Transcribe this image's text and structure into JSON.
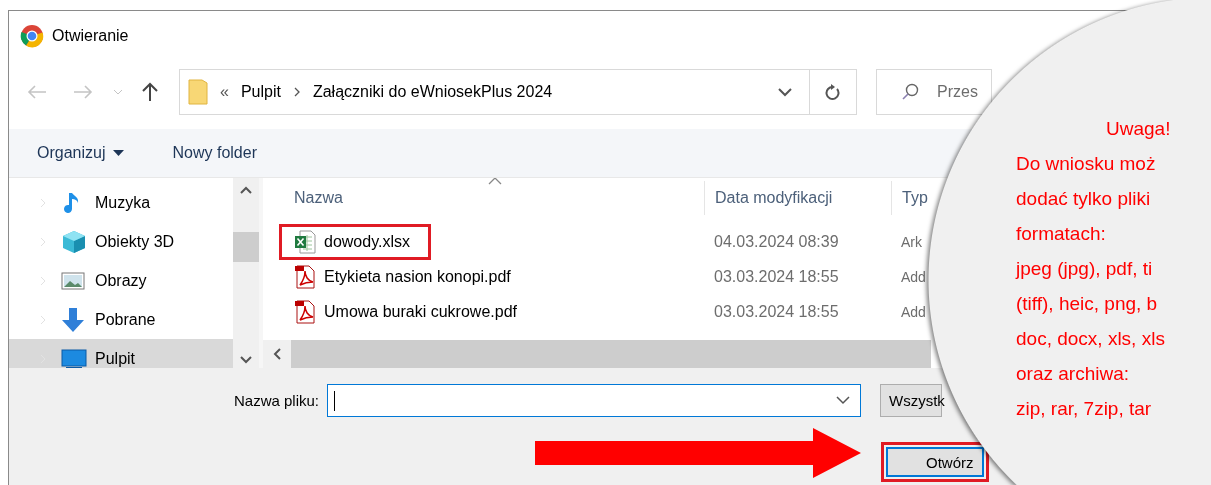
{
  "window": {
    "title": "Otwieranie"
  },
  "address_bar": {
    "overflow": "«",
    "breadcrumbs": [
      "Pulpit",
      "Załączniki do eWniosekPlus 2024"
    ]
  },
  "search": {
    "placeholder": "Przes"
  },
  "toolbar": {
    "organize": "Organizuj",
    "new_folder": "Nowy folder"
  },
  "nav_pane": {
    "items": [
      {
        "label": "Muzyka",
        "kind": "music",
        "selected": false
      },
      {
        "label": "Obiekty 3D",
        "kind": "cube",
        "selected": false
      },
      {
        "label": "Obrazy",
        "kind": "pictures",
        "selected": false
      },
      {
        "label": "Pobrane",
        "kind": "download",
        "selected": false
      },
      {
        "label": "Pulpit",
        "kind": "desktop",
        "selected": true
      }
    ]
  },
  "file_list": {
    "columns": [
      "Nazwa",
      "Data modyfikacji",
      "Typ"
    ],
    "rows": [
      {
        "name": "dowody.xlsx",
        "kind": "excel",
        "date": "04.03.2024 08:39",
        "type": "Ark",
        "highlighted": true
      },
      {
        "name": "Etykieta nasion konopi.pdf",
        "kind": "pdf",
        "date": "03.03.2024 18:55",
        "type": "Add",
        "highlighted": false
      },
      {
        "name": "Umowa buraki cukrowe.pdf",
        "kind": "pdf",
        "date": "03.03.2024 18:55",
        "type": "Add",
        "highlighted": false
      }
    ]
  },
  "file_name": {
    "label": "Nazwa pliku:"
  },
  "file_type_filter": {
    "value": "Wszystk"
  },
  "open_button": {
    "label": "Otwórz",
    "highlighted": true
  },
  "callout": {
    "heading": "Uwaga!",
    "lines": [
      "Do wniosku moż",
      "dodać tylko pliki",
      "formatach:",
      "jpeg (jpg), pdf, ti",
      "(tiff), heic, png, b",
      "doc, docx, xls, xls",
      "oraz archiwa:",
      "zip, rar, 7zip, tar"
    ]
  }
}
